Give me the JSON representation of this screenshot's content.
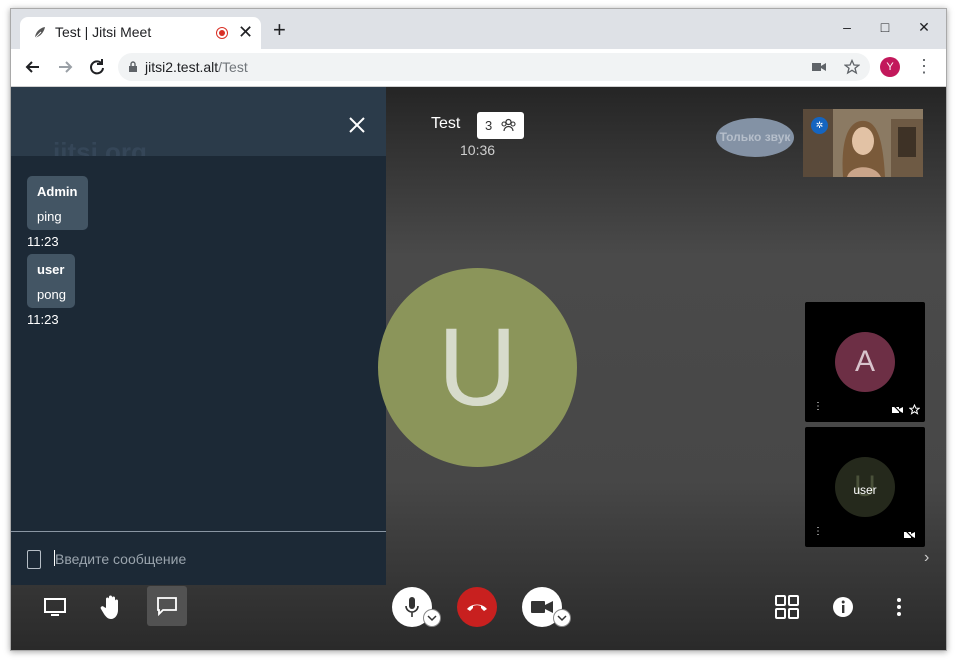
{
  "browser": {
    "tab_title": "Test | Jitsi Meet",
    "tab_close": "✕",
    "new_tab": "+",
    "url_host": "jitsi2.test.alt",
    "url_path": "/Test",
    "profile_initial": "Y",
    "window_controls": [
      "–",
      "□",
      "✕"
    ]
  },
  "chat": {
    "watermark": "jitsi.org",
    "messages": [
      {
        "name": "Admin",
        "text": "ping",
        "time": "11:23"
      },
      {
        "name": "user",
        "text": "pong",
        "time": "11:23"
      }
    ],
    "input_placeholder": "Введите сообщение"
  },
  "conference": {
    "title": "Test",
    "participant_count": "3",
    "timer": "10:36",
    "speaker_initial": "U",
    "audio_only_label": "Только звук"
  },
  "filmstrip": {
    "tiles": [
      {
        "initial": "A",
        "name": "",
        "color": "#6d2f45"
      },
      {
        "initial": "U",
        "name": "user",
        "color": "#25291c"
      }
    ]
  },
  "colors": {
    "chat_bg": "#1c2936",
    "hangup": "#c8201f",
    "speaker_avatar": "#8b955a"
  }
}
